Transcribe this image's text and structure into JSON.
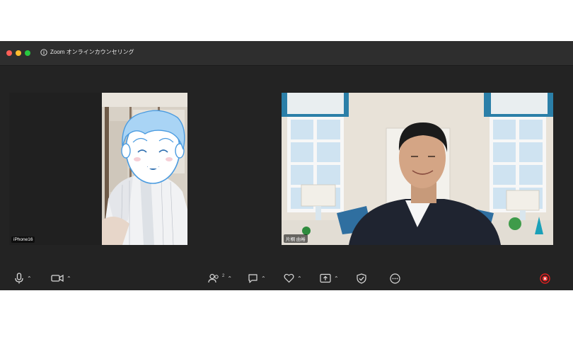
{
  "window": {
    "title": "Zoom オンラインカウンセリング"
  },
  "participants": [
    {
      "name": "iPhone16"
    },
    {
      "name": "片桐 由裕"
    }
  ],
  "toolbar": {
    "participants_count": "2"
  },
  "icons": [
    "info-icon",
    "microphone-icon",
    "video-camera-icon",
    "participants-icon",
    "chat-icon",
    "reactions-icon",
    "share-screen-icon",
    "security-icon",
    "more-icon",
    "leave-icon"
  ],
  "colors": {
    "leave": "#e02020",
    "tile_background": "#1c1c1c"
  }
}
